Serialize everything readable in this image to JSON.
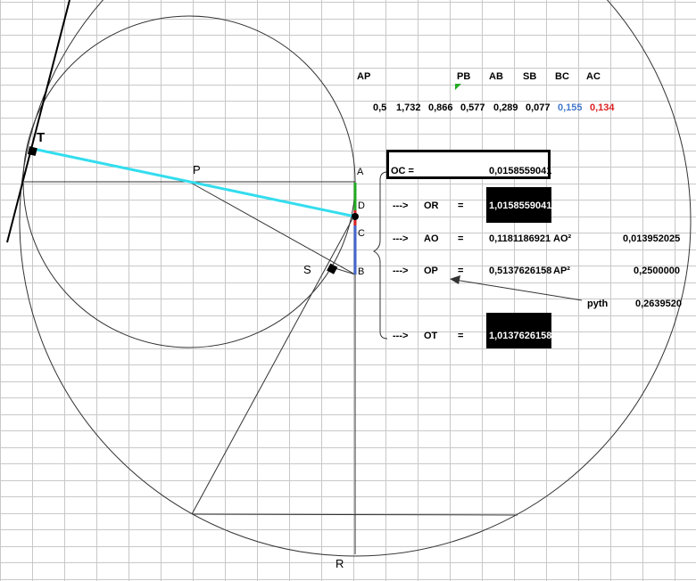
{
  "header": {
    "ap": "AP",
    "pb": "PB",
    "ab": "AB",
    "sb": "SB",
    "bc": "BC",
    "ac": "AC"
  },
  "values": {
    "v1": "0,5",
    "v2": "1,732",
    "v3": "0,866",
    "v4": "0,577",
    "v5": "0,289",
    "v6": "0,077",
    "bc": "0,155",
    "ac": "0,134"
  },
  "rows": {
    "oc_label": "OC =",
    "oc_value": "0,0158559041",
    "arrow": "--->",
    "eq": "=",
    "or_label": "OR",
    "or_value": "1,0158559041",
    "ao_label": "AO",
    "ao_value": "0,1181186921",
    "ao2_label": "AO²",
    "ao2_value": "0,013952025",
    "op_label": "OP",
    "op_value": "0,5137626158",
    "ap2_label": "AP²",
    "ap2_value": "0,2500000",
    "pyth_label": "pyth",
    "pyth_value": "0,2639520",
    "ot_label": "OT",
    "ot_value": "1,0137626158"
  },
  "points": {
    "t": "T",
    "p": "P",
    "a": "A",
    "d": "D",
    "c": "C",
    "b": "B",
    "s": "S",
    "r": "R"
  },
  "colors": {
    "grid": "#c8c8c8",
    "cyan_segment": "#33ddee",
    "green_segment": "#22aa22",
    "blue_segment": "#4466cc",
    "red_segment": "#dd2222",
    "bc_text": "#4477cc",
    "ac_text": "#dd2222"
  }
}
